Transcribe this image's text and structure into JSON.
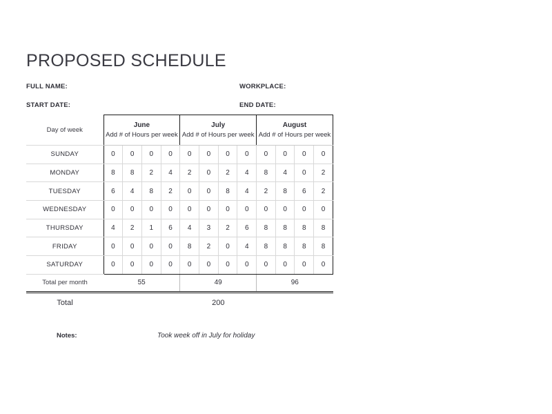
{
  "document": {
    "title": "PROPOSED SCHEDULE",
    "fields": {
      "full_name": "FULL NAME:",
      "start_date": "START DATE:",
      "workplace": "WORKPLACE:",
      "end_date": "END DATE:"
    },
    "notes": {
      "label": "Notes:",
      "text": "Took week off in July for holiday"
    }
  },
  "table": {
    "day_header": "Day of week",
    "month_subtitle": "Add # of Hours per week",
    "months": [
      "June",
      "July",
      "August"
    ],
    "weeks_per_month": 4,
    "days": [
      "SUNDAY",
      "MONDAY",
      "TUESDAY",
      "WEDNESDAY",
      "THURSDAY",
      "FRIDAY",
      "SATURDAY"
    ],
    "rows": [
      {
        "day": "SUNDAY",
        "june": [
          0,
          0,
          0,
          0
        ],
        "july": [
          0,
          0,
          0,
          0
        ],
        "august": [
          0,
          0,
          0,
          0
        ]
      },
      {
        "day": "MONDAY",
        "june": [
          8,
          8,
          2,
          4
        ],
        "july": [
          2,
          0,
          2,
          4
        ],
        "august": [
          8,
          4,
          0,
          2
        ]
      },
      {
        "day": "TUESDAY",
        "june": [
          6,
          4,
          8,
          2
        ],
        "july": [
          0,
          0,
          8,
          4
        ],
        "august": [
          2,
          8,
          6,
          2
        ]
      },
      {
        "day": "WEDNESDAY",
        "june": [
          0,
          0,
          0,
          0
        ],
        "july": [
          0,
          0,
          0,
          0
        ],
        "august": [
          0,
          0,
          0,
          0
        ]
      },
      {
        "day": "THURSDAY",
        "june": [
          4,
          2,
          1,
          6
        ],
        "july": [
          4,
          3,
          2,
          6
        ],
        "august": [
          8,
          8,
          8,
          8
        ]
      },
      {
        "day": "FRIDAY",
        "june": [
          0,
          0,
          0,
          0
        ],
        "july": [
          8,
          2,
          0,
          4
        ],
        "august": [
          8,
          8,
          8,
          8
        ]
      },
      {
        "day": "SATURDAY",
        "june": [
          0,
          0,
          0,
          0
        ],
        "july": [
          0,
          0,
          0,
          0
        ],
        "august": [
          0,
          0,
          0,
          0
        ]
      }
    ],
    "total_per_month_label": "Total per month",
    "totals_per_month": [
      55,
      49,
      96
    ],
    "grand_total_label": "Total",
    "grand_total": 200
  },
  "colors": {
    "text": "#2f2f37",
    "title": "#3a3a42",
    "border_heavy": "#1a1a1a",
    "border_light": "#d8d8d8",
    "background": "#ffffff"
  }
}
